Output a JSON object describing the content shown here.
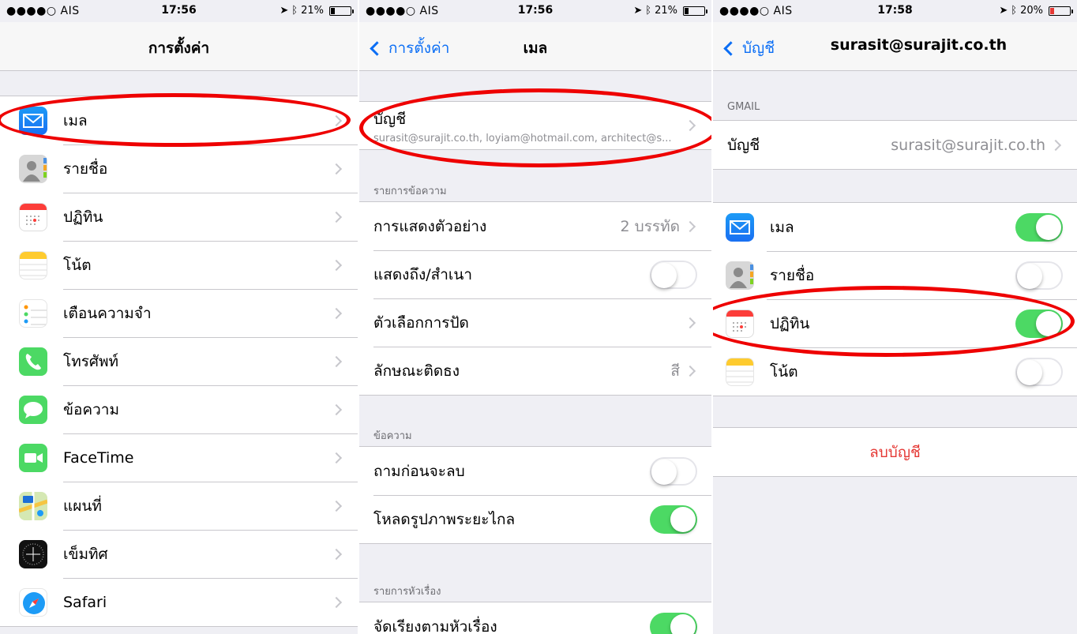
{
  "status": [
    {
      "carrier": "●●●●○ AIS",
      "time": "17:56",
      "battery": "21%",
      "battery_level": 0.21
    },
    {
      "carrier": "●●●●○ AIS",
      "time": "17:56",
      "battery": "21%",
      "battery_level": 0.21
    },
    {
      "carrier": "●●●●○ AIS",
      "time": "17:58",
      "battery": "20%",
      "battery_level": 0.2
    }
  ],
  "settings": {
    "title": "การตั้งค่า",
    "items": [
      {
        "label": "เมล",
        "icon": "mail-icon"
      },
      {
        "label": "รายชื่อ",
        "icon": "contacts-icon"
      },
      {
        "label": "ปฏิทิน",
        "icon": "calendar-icon"
      },
      {
        "label": "โน้ต",
        "icon": "notes-icon"
      },
      {
        "label": "เตือนความจำ",
        "icon": "reminders-icon"
      },
      {
        "label": "โทรศัพท์",
        "icon": "phone-icon"
      },
      {
        "label": "ข้อความ",
        "icon": "messages-icon"
      },
      {
        "label": "FaceTime",
        "icon": "facetime-icon"
      },
      {
        "label": "แผนที่",
        "icon": "maps-icon"
      },
      {
        "label": "เข็มทิศ",
        "icon": "compass-icon"
      },
      {
        "label": "Safari",
        "icon": "safari-icon"
      }
    ]
  },
  "mail": {
    "back": "การตั้งค่า",
    "title": "เมล",
    "accounts_label": "บัญชี",
    "accounts_sub": "surasit@surajit.co.th, loyiam@hotmail.com, architect@s...",
    "section_list": "รายการข้อความ",
    "preview_label": "การแสดงตัวอย่าง",
    "preview_value": "2 บรรทัด",
    "show_tocc": "แสดงถึง/สำเนา",
    "swipe_options": "ตัวเลือกการปัด",
    "flag_style": "ลักษณะติดธง",
    "flag_value": "สี",
    "section_messages": "ข้อความ",
    "ask_before_delete": "ถามก่อนจะลบ",
    "load_remote_images": "โหลดรูปภาพระยะไกล",
    "section_threading": "รายการหัวเรื่อง",
    "organize_by_thread": "จัดเรียงตามหัวเรื่อง",
    "toggles": {
      "show_tocc": false,
      "ask_before_delete": false,
      "load_remote_images": true,
      "organize_by_thread": true
    }
  },
  "account": {
    "back": "บัญชี",
    "title": "surasit@surajit.co.th",
    "section": "GMAIL",
    "account_label": "บัญชี",
    "account_value": "surasit@surajit.co.th",
    "services": [
      {
        "label": "เมล",
        "icon": "mail-icon",
        "on": true
      },
      {
        "label": "รายชื่อ",
        "icon": "contacts-icon",
        "on": false
      },
      {
        "label": "ปฏิทิน",
        "icon": "calendar-icon",
        "on": true
      },
      {
        "label": "โน้ต",
        "icon": "notes-icon",
        "on": false
      }
    ],
    "delete": "ลบบัญชี"
  },
  "colors": {
    "ios_blue": "#0b6ef5",
    "ios_green": "#4cd964",
    "delete_red": "#e53935",
    "annotation_red": "#e00000"
  }
}
